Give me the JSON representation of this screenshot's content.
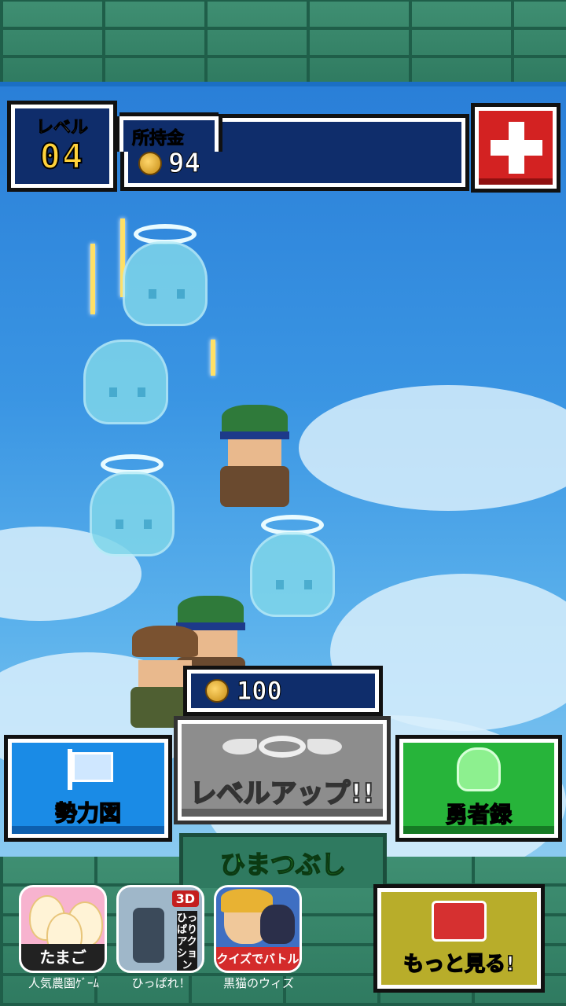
{
  "hud": {
    "level_label": "レベル",
    "level_value": "04",
    "money_label": "所持金",
    "money_value": "94"
  },
  "levelup": {
    "cost": "100",
    "label": "レベルアップ!!"
  },
  "buttons": {
    "map_label": "勢力図",
    "record_label": "勇者録",
    "more_label": "もっと見る!"
  },
  "section_title": "ひまつぶし",
  "apps": [
    {
      "tag": "たまご",
      "caption": "人気農園ｹﾞｰﾑ"
    },
    {
      "badge": "3D",
      "tag": "ひっぱりアクション",
      "caption": "ひっぱれ！"
    },
    {
      "tag": "クイズでバトル",
      "caption": "黒猫のウィズ"
    }
  ],
  "colors": {
    "sky": "#3a95e3",
    "brick": "#2f7a60",
    "hud_bg": "#0f2d6b",
    "coin": "#ffd66b",
    "cross_btn": "#d32222",
    "map_btn": "#1a8be6",
    "record_btn": "#27b43a",
    "levelup_btn": "#8d8d8d",
    "more_btn": "#b8ad2a"
  },
  "icons": [
    "coin-icon",
    "medical-cross-icon",
    "flag-icon",
    "angel-wings-icon",
    "ghost-icon",
    "treasure-chest-icon"
  ]
}
